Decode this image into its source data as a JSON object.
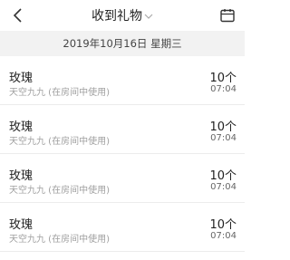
{
  "header": {
    "title": "收到礼物",
    "back_icon": "chevron-left-icon",
    "title_dropdown_icon": "chevron-down-icon",
    "calendar_icon": "calendar-icon"
  },
  "date_header": "2019年10月16日 星期三",
  "gifts": [
    {
      "name": "玫瑰",
      "source": "天空九九 (在房间中使用)",
      "count": "10个",
      "time": "07:04"
    },
    {
      "name": "玫瑰",
      "source": "天空九九 (在房间中使用)",
      "count": "10个",
      "time": "07:04"
    },
    {
      "name": "玫瑰",
      "source": "天空九九 (在房间中使用)",
      "count": "10个",
      "time": "07:04"
    },
    {
      "name": "玫瑰",
      "source": "天空九九 (在房间中使用)",
      "count": "10个",
      "time": "07:04"
    }
  ]
}
